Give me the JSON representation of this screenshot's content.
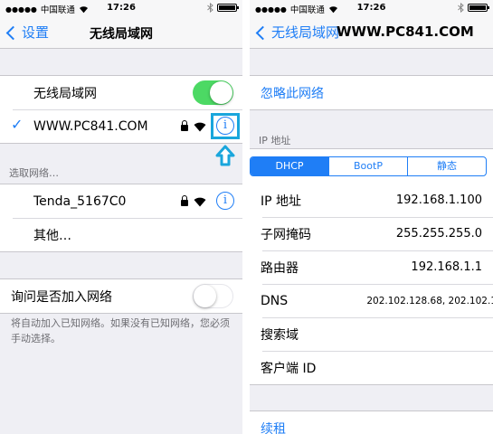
{
  "left": {
    "status": {
      "carrier": "中国联通",
      "time": "17:26"
    },
    "nav": {
      "back_label": "设置",
      "title": "无线局域网"
    },
    "wlan_row": {
      "label": "无线局域网",
      "switch_on": true
    },
    "current_network": {
      "name": "WWW.PC841.COM",
      "secured": true
    },
    "choose_network_header": "选取网络…",
    "networks": [
      {
        "name": "Tenda_5167C0",
        "secured": true
      },
      {
        "name": "其他…"
      }
    ],
    "ask_join": {
      "label": "询问是否加入网络",
      "switch_on": false
    },
    "ask_join_note": "将自动加入已知网络。如果没有已知网络，您必须手动选择。"
  },
  "right": {
    "status": {
      "carrier": "中国联通",
      "time": "17:26"
    },
    "nav": {
      "back_label": "无线局域网",
      "title": "WWW.PC841.COM"
    },
    "forget_label": "忽略此网络",
    "ip_header": "IP 地址",
    "segments": [
      "DHCP",
      "BootP",
      "静态"
    ],
    "selected_segment": "DHCP",
    "fields": [
      {
        "label": "IP 地址",
        "value": "192.168.1.100"
      },
      {
        "label": "子网掩码",
        "value": "255.255.255.0"
      },
      {
        "label": "路由器",
        "value": "192.168.1.1"
      },
      {
        "label": "DNS",
        "value": "202.102.128.68, 202.102.1"
      },
      {
        "label": "搜索域",
        "value": ""
      },
      {
        "label": "客户端 ID",
        "value": ""
      }
    ],
    "renew_label": "续租"
  },
  "colors": {
    "accent": "#1f7ef6",
    "switch_on": "#4cd964",
    "highlight": "#1aa6dc",
    "background": "#efeff4"
  },
  "icons": [
    "wifi-icon",
    "lock-icon",
    "info-icon",
    "bluetooth-icon",
    "battery-icon",
    "up-arrow-icon",
    "checkmark-icon"
  ]
}
